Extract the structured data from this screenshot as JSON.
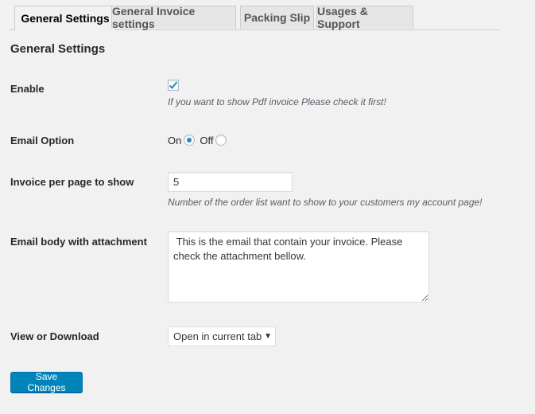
{
  "tabs": [
    {
      "label": "General Settings",
      "active": true
    },
    {
      "label": "General Invoice settings",
      "active": false
    },
    {
      "label": "Packing Slip",
      "active": false
    },
    {
      "label": "Usages & Support",
      "active": false
    }
  ],
  "section_title": "General Settings",
  "fields": {
    "enable": {
      "label": "Enable",
      "checked": true,
      "description": "If you want to show Pdf invoice Please check it first!"
    },
    "email_option": {
      "label": "Email Option",
      "on_label": "On",
      "off_label": "Off",
      "selected": "On"
    },
    "invoice_per_page": {
      "label": "Invoice per page to show",
      "value": "5",
      "description": "Number of the order list want to show to your customers my account page!"
    },
    "email_body": {
      "label": "Email body with attachment",
      "value": " This is the email that contain your invoice. Please check the attachment bellow."
    },
    "view_or_download": {
      "label": "View or Download",
      "selected_option": "Open in current tab"
    }
  },
  "save_button": "Save Changes",
  "colors": {
    "primary_button": "#0085ba",
    "radio_dot": "#1e8cbe",
    "checkmark": "#1e8cbe"
  }
}
